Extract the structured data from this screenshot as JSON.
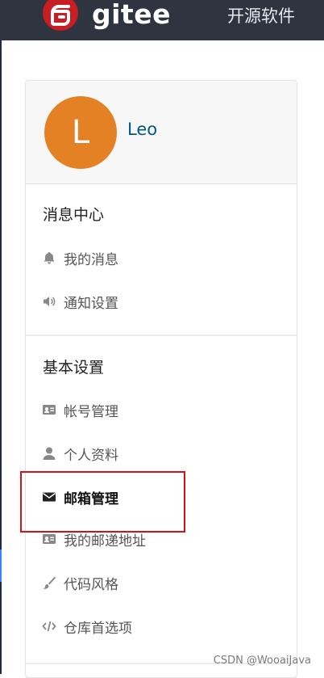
{
  "header": {
    "brand": "gitee",
    "nav_item": "开源软件"
  },
  "profile": {
    "avatar_letter": "L",
    "username": "Leo",
    "avatar_color": "#e58125"
  },
  "sections": [
    {
      "title": "消息中心",
      "items": [
        {
          "label": "我的消息",
          "icon": "bell-icon"
        },
        {
          "label": "通知设置",
          "icon": "volume-icon"
        }
      ]
    },
    {
      "title": "基本设置",
      "items": [
        {
          "label": "帐号管理",
          "icon": "id-card-icon"
        },
        {
          "label": "个人资料",
          "icon": "user-icon"
        },
        {
          "label": "邮箱管理",
          "icon": "envelope-icon",
          "active": true
        },
        {
          "label": "我的邮递地址",
          "icon": "id-card-icon"
        },
        {
          "label": "代码风格",
          "icon": "brush-icon"
        },
        {
          "label": "仓库首选项",
          "icon": "code-icon"
        }
      ]
    }
  ],
  "watermark": "CSDN @WooaiJava"
}
